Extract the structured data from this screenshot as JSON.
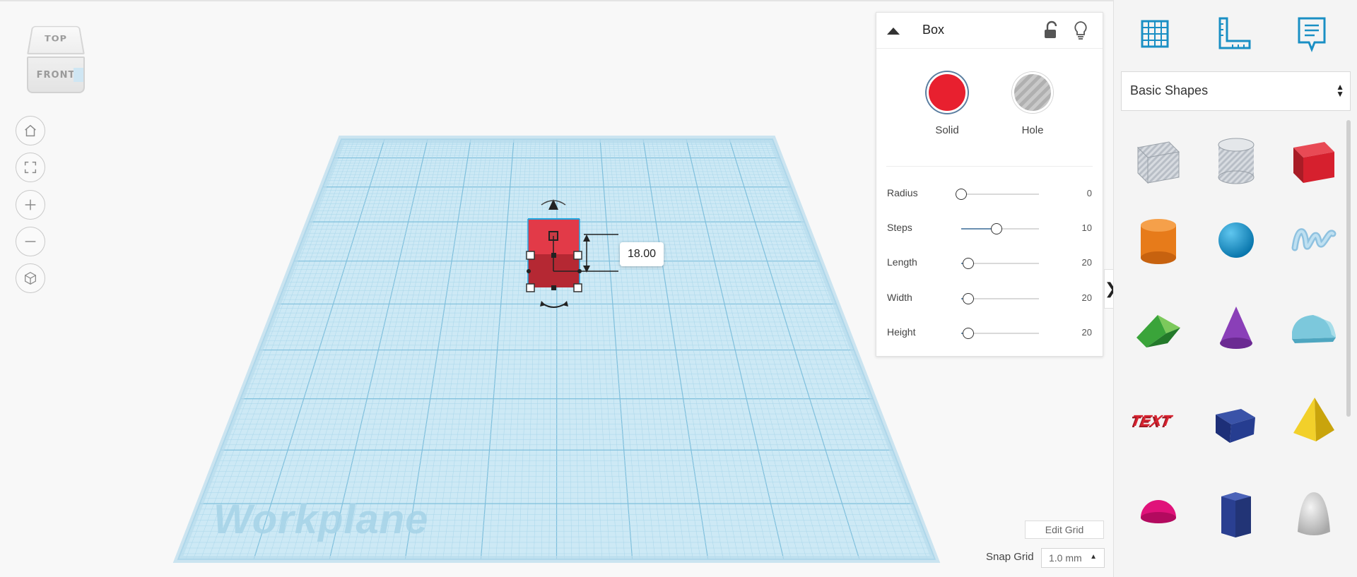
{
  "viewcube": {
    "top": "TOP",
    "front": "FRONT"
  },
  "workplane": {
    "watermark": "Workplane"
  },
  "selection": {
    "dimension_value": "18.00"
  },
  "inspector": {
    "title": "Box",
    "solid_label": "Solid",
    "hole_label": "Hole",
    "solid_color": "#e8202f",
    "properties": [
      {
        "label": "Radius",
        "value": "0",
        "fraction": 0.0
      },
      {
        "label": "Steps",
        "value": "10",
        "fraction": 0.45
      },
      {
        "label": "Length",
        "value": "20",
        "fraction": 0.09
      },
      {
        "label": "Width",
        "value": "20",
        "fraction": 0.09
      },
      {
        "label": "Height",
        "value": "20",
        "fraction": 0.09
      }
    ]
  },
  "shapes_panel": {
    "category": "Basic Shapes",
    "shapes": [
      "box-hole-icon",
      "cylinder-hole-icon",
      "box-icon",
      "cylinder-icon",
      "sphere-icon",
      "scribble-icon",
      "roof-icon",
      "cone-icon",
      "round-roof-icon",
      "text-icon",
      "wedge-icon",
      "pyramid-icon",
      "half-sphere-icon",
      "polygon-icon",
      "paraboloid-icon"
    ]
  },
  "bottom": {
    "edit_grid": "Edit Grid",
    "snap_grid_label": "Snap Grid",
    "snap_grid_value": "1.0 mm"
  },
  "colors": {
    "accent_blue": "#1a8fc4",
    "grid_blue": "#a9d9ee"
  }
}
